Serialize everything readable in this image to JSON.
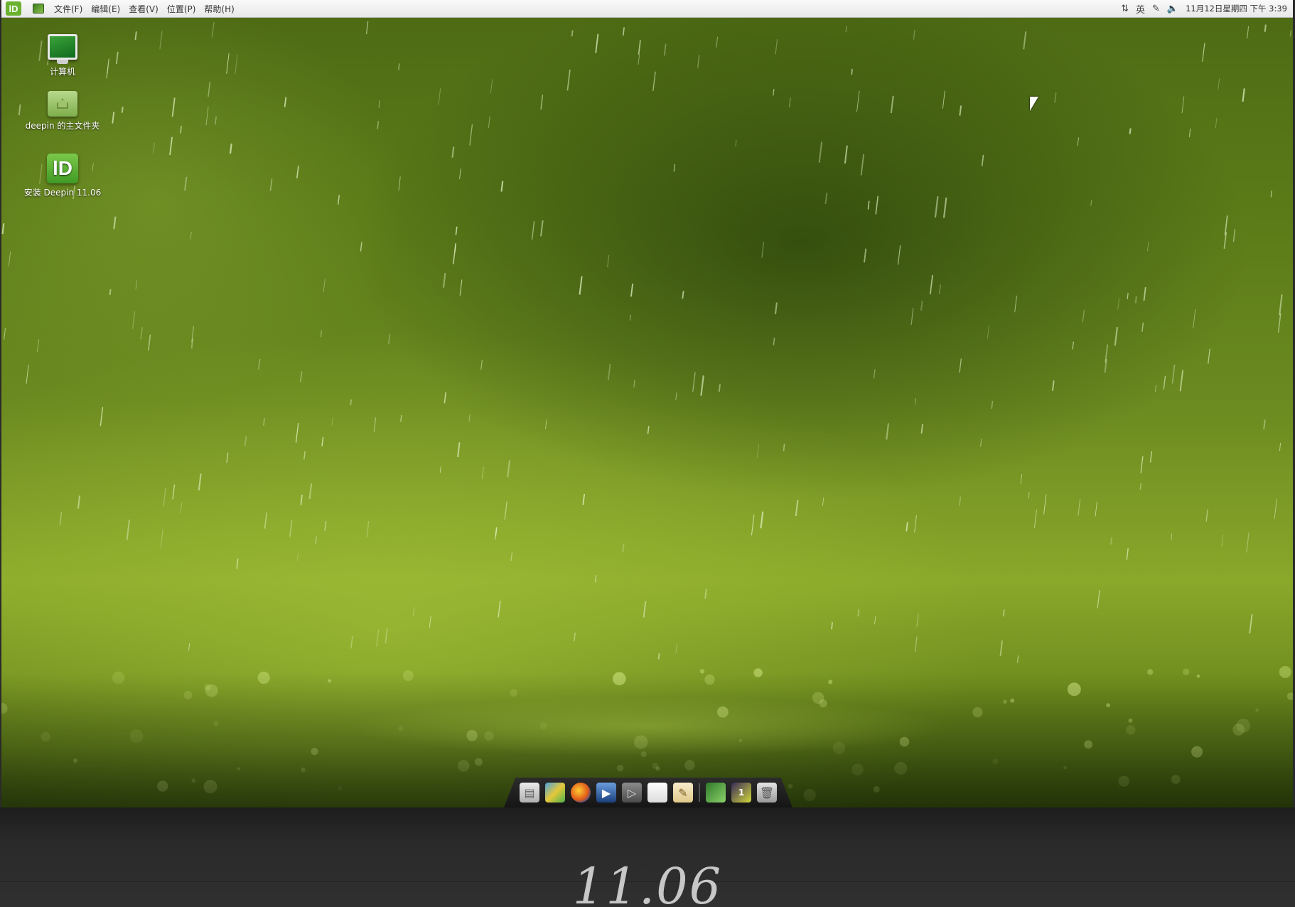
{
  "topbar": {
    "logo_text": "lD",
    "menus": [
      "文件(F)",
      "编辑(E)",
      "查看(V)",
      "位置(P)",
      "帮助(H)"
    ],
    "tray": {
      "input_method": "英",
      "clock": "11月12日星期四 下午 3:39",
      "icons": [
        "network-icon",
        "input-method-icon",
        "tools-icon",
        "volume-icon"
      ]
    }
  },
  "desktop": {
    "icons": [
      {
        "name": "computer",
        "label": "计算机"
      },
      {
        "name": "home-folder",
        "label": "deepin 的主文件夹"
      },
      {
        "name": "install-deepin",
        "label": "安装 Deepin 11.06"
      }
    ]
  },
  "dock": {
    "items": [
      "files-icon",
      "photos-icon",
      "firefox-icon",
      "video-icon",
      "media-player-icon",
      "document-icon",
      "notes-icon",
      "system-monitor-icon",
      "workspace-switcher-icon",
      "trash-icon"
    ],
    "workspace_number": "1"
  },
  "caption": {
    "text": "11.06"
  },
  "colors": {
    "accent": "#6bb230",
    "panel_bg": "#f1f1f1",
    "dock_bg": "#1e1e1e"
  }
}
